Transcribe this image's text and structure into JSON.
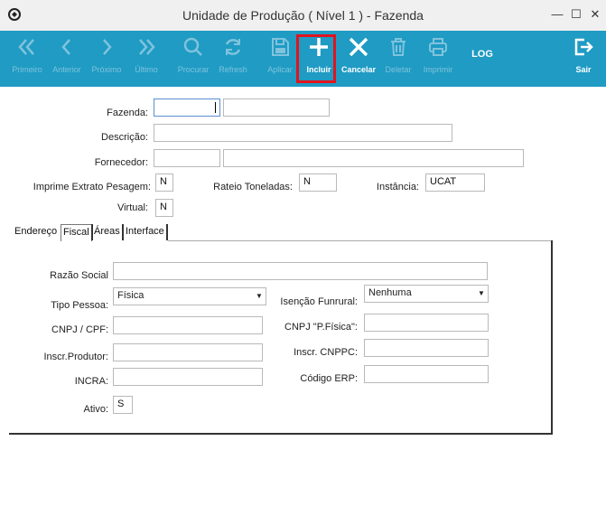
{
  "window": {
    "title": "Unidade de Produção ( Nível 1 ) - Fazenda",
    "controls": {
      "minimize": "—",
      "maximize": "☐",
      "close": "✕"
    }
  },
  "toolbar": {
    "buttons": [
      {
        "id": "primeiro",
        "label": "Primeiro",
        "icon": "double-chevron-left-icon",
        "enabled": false
      },
      {
        "id": "anterior",
        "label": "Anterior",
        "icon": "chevron-left-icon",
        "enabled": false
      },
      {
        "id": "proximo",
        "label": "Próximo",
        "icon": "chevron-right-icon",
        "enabled": false
      },
      {
        "id": "ultimo",
        "label": "Último",
        "icon": "double-chevron-right-icon",
        "enabled": false
      },
      {
        "id": "procurar",
        "label": "Procurar",
        "icon": "search-icon",
        "enabled": false
      },
      {
        "id": "refresh",
        "label": "Refresh",
        "icon": "refresh-icon",
        "enabled": false
      },
      {
        "id": "aplicar",
        "label": "Aplicar",
        "icon": "save-icon",
        "enabled": false
      },
      {
        "id": "incluir",
        "label": "Incluir",
        "icon": "plus-icon",
        "enabled": true
      },
      {
        "id": "cancelar",
        "label": "Cancelar",
        "icon": "close-icon",
        "enabled": true
      },
      {
        "id": "deletar",
        "label": "Deletar",
        "icon": "trash-icon",
        "enabled": false
      },
      {
        "id": "imprimir",
        "label": "Imprimir",
        "icon": "printer-icon",
        "enabled": false
      }
    ],
    "log_label": "LOG",
    "sair_label": "Sair",
    "colors": {
      "bar": "#1f9bc4",
      "highlight": "#e0141e"
    }
  },
  "form": {
    "fazenda": {
      "label": "Fazenda:",
      "code": "",
      "name": ""
    },
    "descricao": {
      "label": "Descrição:",
      "value": ""
    },
    "fornecedor": {
      "label": "Fornecedor:",
      "code": "",
      "name": ""
    },
    "imprime_extrato": {
      "label": "Imprime Extrato Pesagem:",
      "value": "N"
    },
    "rateio": {
      "label": "Rateio Toneladas:",
      "value": "N"
    },
    "instancia": {
      "label": "Instância:",
      "value": "UCAT"
    },
    "virtual": {
      "label": "Virtual:",
      "value": "N"
    }
  },
  "tabs": [
    {
      "label": "Endereço",
      "active": false
    },
    {
      "label": "Fiscal",
      "active": true
    },
    {
      "label": "Áreas",
      "active": false
    },
    {
      "label": "Interface",
      "active": false
    }
  ],
  "fiscal": {
    "razao_social": {
      "label": "Razão Social",
      "value": ""
    },
    "tipo_pessoa": {
      "label": "Tipo Pessoa:",
      "value": "Física"
    },
    "isencao_funrural": {
      "label": "Isenção Funrural:",
      "value": "Nenhuma"
    },
    "cnpj_cpf": {
      "label": "CNPJ / CPF:",
      "value": ""
    },
    "cnpj_pfisica": {
      "label": "CNPJ \"P.Física\":",
      "value": ""
    },
    "inscr_produtor": {
      "label": "Inscr.Produtor:",
      "value": ""
    },
    "inscr_cnppc": {
      "label": "Inscr. CNPPC:",
      "value": ""
    },
    "incra": {
      "label": "INCRA:",
      "value": ""
    },
    "codigo_erp": {
      "label": "Código ERP:",
      "value": ""
    },
    "ativo": {
      "label": "Ativo:",
      "value": "S"
    }
  }
}
